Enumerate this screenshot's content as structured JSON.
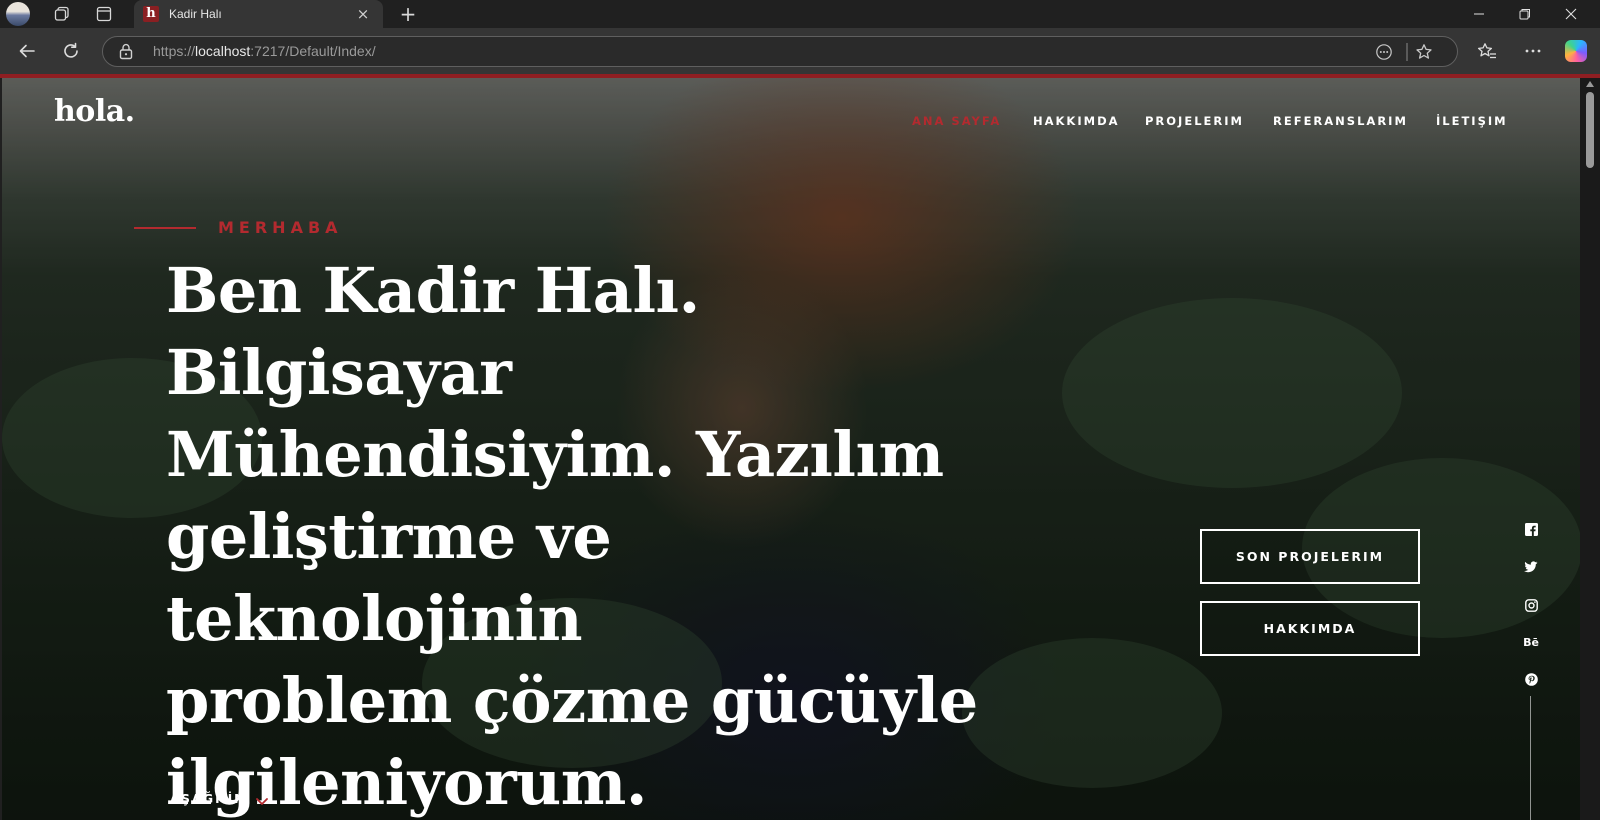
{
  "browser": {
    "tab_title": "Kadir Halı",
    "tab_favicon_letter": "h",
    "tab_close_glyph": "×",
    "new_tab_glyph": "+",
    "url_prefix": "https://",
    "url_host": "localhost",
    "url_rest": ":7217/Default/Index/",
    "accent_color": "#8f1e22"
  },
  "page": {
    "logo": "hola.",
    "nav": [
      {
        "label": "ANA SAYFA",
        "active": true
      },
      {
        "label": "HAKKIMDA",
        "active": false
      },
      {
        "label": "PROJELERIM",
        "active": false
      },
      {
        "label": "REFERANSLARIM",
        "active": false
      },
      {
        "label": "İLETIŞIM",
        "active": false
      }
    ],
    "eyebrow": "MERHABA",
    "headline_lines": [
      "Ben Kadir Halı. Bilgisayar",
      "Mühendisiyim. Yazılım",
      "geliştirme ve teknolojinin",
      "problem çözme gücüyle",
      "ilgileniyorum."
    ],
    "buttons": {
      "projects": "SON PROJELERIM",
      "about": "HAKKIMDA"
    },
    "social": [
      {
        "icon": "facebook-icon"
      },
      {
        "icon": "twitter-icon"
      },
      {
        "icon": "instagram-icon"
      },
      {
        "icon": "behance-icon",
        "label": "Bē"
      },
      {
        "icon": "pinterest-icon"
      }
    ],
    "scroll_down": "AŞAĞI İN",
    "accent_color": "#b32a2f"
  }
}
